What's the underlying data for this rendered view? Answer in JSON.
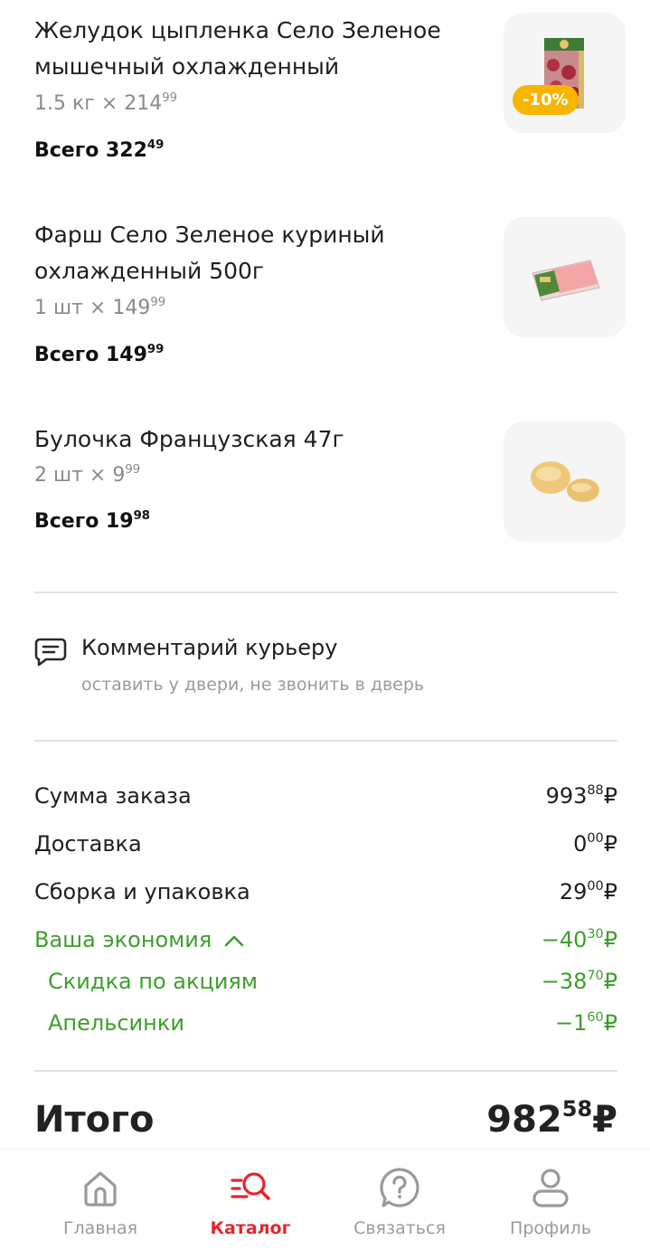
{
  "products": [
    {
      "name_line1": "Желудок цыпленка Село Зеленое",
      "name_line2": "мышечный охлажденный",
      "qty_prefix": "1.5 кг × 214",
      "qty_cents": "99",
      "total_prefix": "Всего 322",
      "total_cents": "49",
      "badge": "-10%"
    },
    {
      "name_line1": "Фарш Село Зеленое куриный",
      "name_line2": "охлажденный 500г",
      "qty_prefix": "1 шт × 149",
      "qty_cents": "99",
      "total_prefix": "Всего 149",
      "total_cents": "99"
    },
    {
      "name_line1": "Булочка Французская 47г",
      "qty_prefix": "2 шт × 9",
      "qty_cents": "99",
      "total_prefix": "Всего 19",
      "total_cents": "98"
    }
  ],
  "comment": {
    "title": "Комментарий курьеру",
    "hint": "оставить у двери, не звонить в дверь"
  },
  "summary": {
    "order_label": "Сумма заказа",
    "order_int": "993",
    "order_cents": "88",
    "delivery_label": "Доставка",
    "delivery_int": "0",
    "delivery_cents": "00",
    "packing_label": "Сборка и упаковка",
    "packing_int": "29",
    "packing_cents": "00",
    "savings_label": "Ваша экономия",
    "savings_int": "−40",
    "savings_cents": "30",
    "promo_label": "Скидка по акциям",
    "promo_int": "−38",
    "promo_cents": "70",
    "orange_label": "Апельсинки",
    "orange_int": "−1",
    "orange_cents": "60",
    "currency": "₽"
  },
  "total": {
    "label": "Итого",
    "int": "982",
    "cents": "58",
    "currency": "₽"
  },
  "tabs": [
    {
      "label": "Главная",
      "icon": "home-icon"
    },
    {
      "label": "Каталог",
      "icon": "catalog-search-icon",
      "active": true
    },
    {
      "label": "Связаться",
      "icon": "help-chat-icon"
    },
    {
      "label": "Профиль",
      "icon": "profile-icon"
    }
  ],
  "colors": {
    "accent": "#e5262c",
    "savings_green": "#3f9e2e",
    "badge": "#f7b500"
  }
}
